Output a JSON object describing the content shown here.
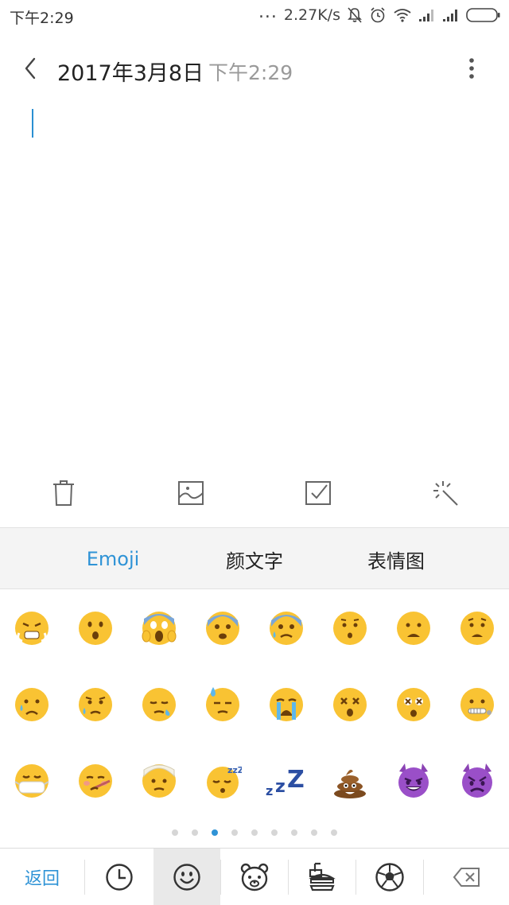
{
  "status_bar": {
    "time": "下午2:29",
    "dots": "...",
    "network_speed": "2.27K/s",
    "icons": [
      "mute-icon",
      "alarm-icon",
      "wifi-icon",
      "signal-icon",
      "signal-icon",
      "battery-icon"
    ]
  },
  "header": {
    "date": "2017年3月8日",
    "time": "下午2:29",
    "back_icon": "chevron-left-icon",
    "more_icon": "more-vertical-icon"
  },
  "toolbar": {
    "items": [
      "trash-icon",
      "image-icon",
      "checkbox-icon",
      "magic-wand-icon"
    ]
  },
  "keyboard": {
    "tabs": [
      {
        "label": "Emoji",
        "active": true
      },
      {
        "label": "颜文字",
        "active": false
      },
      {
        "label": "表情图",
        "active": false
      }
    ],
    "emojis": [
      [
        "😤",
        "😮",
        "😱",
        "😨",
        "😰",
        "😯",
        "😦",
        "😧"
      ],
      [
        "😢",
        "😥",
        "😪",
        "😓",
        "😭",
        "😵",
        "😲",
        "🤐"
      ],
      [
        "😷",
        "🤒",
        "🤕",
        "😴",
        "💤",
        "💩",
        "😈",
        "👿"
      ]
    ],
    "pager": {
      "count": 9,
      "active_index": 2
    },
    "bottom_bar": {
      "return_label": "返回",
      "categories": [
        "clock-icon",
        "smiley-icon",
        "bear-icon",
        "food-icon",
        "soccer-ball-icon"
      ],
      "active_category": 1,
      "delete_icon": "backspace-icon"
    }
  },
  "colors": {
    "accent": "#2f93d6",
    "cursor": "#2a8fd2",
    "muted_text": "#9a9a9a"
  }
}
